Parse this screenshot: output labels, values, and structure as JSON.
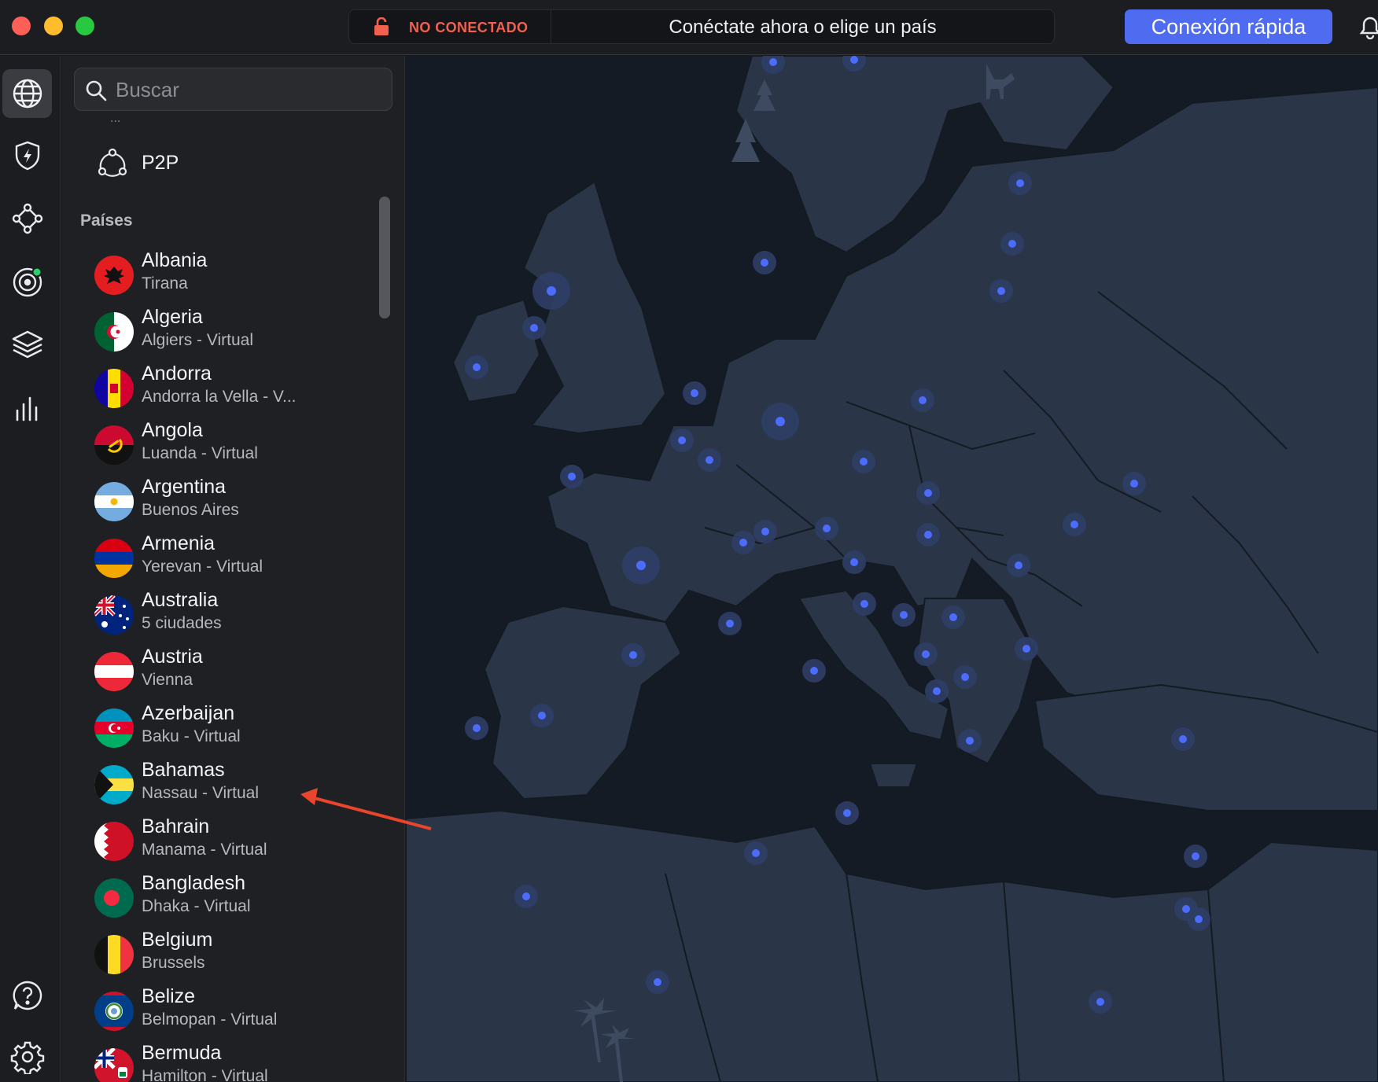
{
  "titlebar": {
    "status": "NO CONECTADO",
    "message": "Conéctate ahora o elige un país",
    "quick_connect": "Conexión rápida"
  },
  "colors": {
    "accent": "#4f6cf0",
    "status_red": "#f2604f",
    "server_dot": "#4c6bff"
  },
  "rail": {
    "items": [
      {
        "icon": "globe-icon",
        "active": true
      },
      {
        "icon": "shield-bolt-icon"
      },
      {
        "icon": "meshnet-icon"
      },
      {
        "icon": "radar-icon"
      },
      {
        "icon": "layers-icon"
      },
      {
        "icon": "stats-icon"
      }
    ],
    "bottom": [
      {
        "icon": "help-icon"
      },
      {
        "icon": "gear-icon"
      }
    ]
  },
  "search": {
    "placeholder": "Buscar"
  },
  "panel": {
    "dots": "...",
    "p2p_label": "P2P",
    "countries_title": "Países",
    "countries": [
      {
        "name": "Albania",
        "sub": "Tirana"
      },
      {
        "name": "Algeria",
        "sub": "Algiers - Virtual"
      },
      {
        "name": "Andorra",
        "sub": "Andorra la Vella - V..."
      },
      {
        "name": "Angola",
        "sub": "Luanda - Virtual"
      },
      {
        "name": "Argentina",
        "sub": "Buenos Aires"
      },
      {
        "name": "Armenia",
        "sub": "Yerevan - Virtual"
      },
      {
        "name": "Australia",
        "sub": "5 ciudades"
      },
      {
        "name": "Austria",
        "sub": "Vienna"
      },
      {
        "name": "Azerbaijan",
        "sub": "Baku - Virtual"
      },
      {
        "name": "Bahamas",
        "sub": "Nassau - Virtual"
      },
      {
        "name": "Bahrain",
        "sub": "Manama - Virtual"
      },
      {
        "name": "Bangladesh",
        "sub": "Dhaka - Virtual"
      },
      {
        "name": "Belgium",
        "sub": "Brussels"
      },
      {
        "name": "Belize",
        "sub": "Belmopan - Virtual"
      },
      {
        "name": "Bermuda",
        "sub": "Hamilton - Virtual"
      }
    ]
  }
}
